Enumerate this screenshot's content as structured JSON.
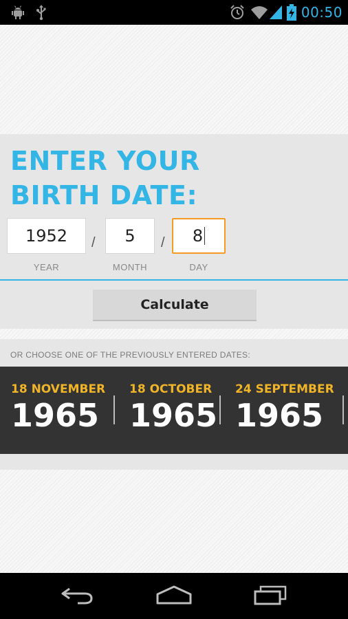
{
  "status_bar": {
    "time": "00:50",
    "left_icons": [
      "android-debug-icon",
      "usb-icon"
    ],
    "right_icons": [
      "alarm-icon",
      "wifi-icon",
      "signal-icon",
      "battery-charging-icon"
    ],
    "accent_color": "#33b5e5"
  },
  "entry": {
    "heading_line1": "ENTER YOUR",
    "heading_line2": "BIRTH DATE:",
    "year_value": "1952",
    "month_value": "5",
    "day_value": "8",
    "separator": "/",
    "year_label": "YEAR",
    "month_label": "MONTH",
    "day_label": "DAY",
    "focused_field": "day",
    "focus_color": "#f59a22"
  },
  "calculate_button": {
    "label": "Calculate"
  },
  "previous": {
    "label": "OR CHOOSE ONE OF THE PREVIOUSLY ENTERED DATES:",
    "dates": [
      {
        "day_month": "18 NOVEMBER",
        "year": "1965"
      },
      {
        "day_month": "18 OCTOBER",
        "year": "1965"
      },
      {
        "day_month": "24 SEPTEMBER",
        "year": "1965"
      }
    ],
    "date_color": "#f0b429",
    "strip_color": "#333333"
  },
  "nav_bar": {
    "buttons": [
      "back-icon",
      "home-icon",
      "recent-apps-icon"
    ]
  }
}
